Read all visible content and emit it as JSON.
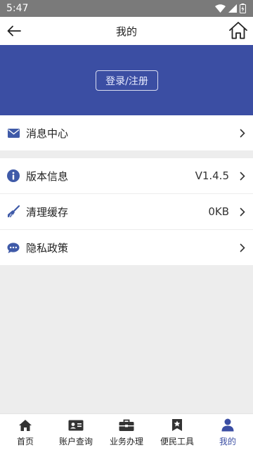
{
  "status_bar": {
    "time": "5:47"
  },
  "nav": {
    "title": "我的"
  },
  "banner": {
    "login_label": "登录/注册",
    "bg_color": "#3b4ea3"
  },
  "menu": {
    "messages": {
      "label": "消息中心",
      "icon": "mail-icon"
    },
    "items": [
      {
        "label": "版本信息",
        "value": "V1.4.5",
        "icon": "info-icon"
      },
      {
        "label": "清理缓存",
        "value": "0KB",
        "icon": "broom-icon"
      },
      {
        "label": "隐私政策",
        "value": "",
        "icon": "chat-icon"
      }
    ]
  },
  "tabs": [
    {
      "label": "首页",
      "icon": "home-icon",
      "active": false
    },
    {
      "label": "账户查询",
      "icon": "id-card-icon",
      "active": false
    },
    {
      "label": "业务办理",
      "icon": "briefcase-icon",
      "active": false
    },
    {
      "label": "便民工具",
      "icon": "bookmark-star-icon",
      "active": false
    },
    {
      "label": "我的",
      "icon": "user-icon",
      "active": true
    }
  ],
  "colors": {
    "accent": "#3b4ea3",
    "icon_blue": "#3f5aa8"
  }
}
